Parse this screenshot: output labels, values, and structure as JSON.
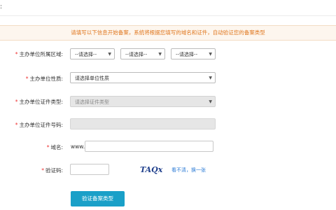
{
  "topbar": {
    "text": ":"
  },
  "notice": "请填写以下信息开始备案，系统将根据您填写的域名和证件，自动验证您的备案类型",
  "form": {
    "region_label": "主办单位所属区域",
    "region_selects": [
      "--请选择--",
      "--请选择--",
      "--请选择--"
    ],
    "nature_label": "主办单位性质",
    "nature_value": "请选择单位性质",
    "cert_type_label": "主办单位证件类型",
    "cert_type_value": "请选择证件类型",
    "cert_no_label": "主办单位证件号码",
    "domain_label": "域名",
    "domain_prefix": "www.",
    "captcha_label": "验证码",
    "captcha_text": "TAQx",
    "captcha_refresh": "看不清，换一张",
    "required_mark": "*",
    "colon": ":"
  },
  "submit_label": "验证备案类型",
  "colors": {
    "accent": "#1aa0c8",
    "notice_text": "#e0771f",
    "required": "#e33333",
    "link": "#2b7bd6"
  }
}
